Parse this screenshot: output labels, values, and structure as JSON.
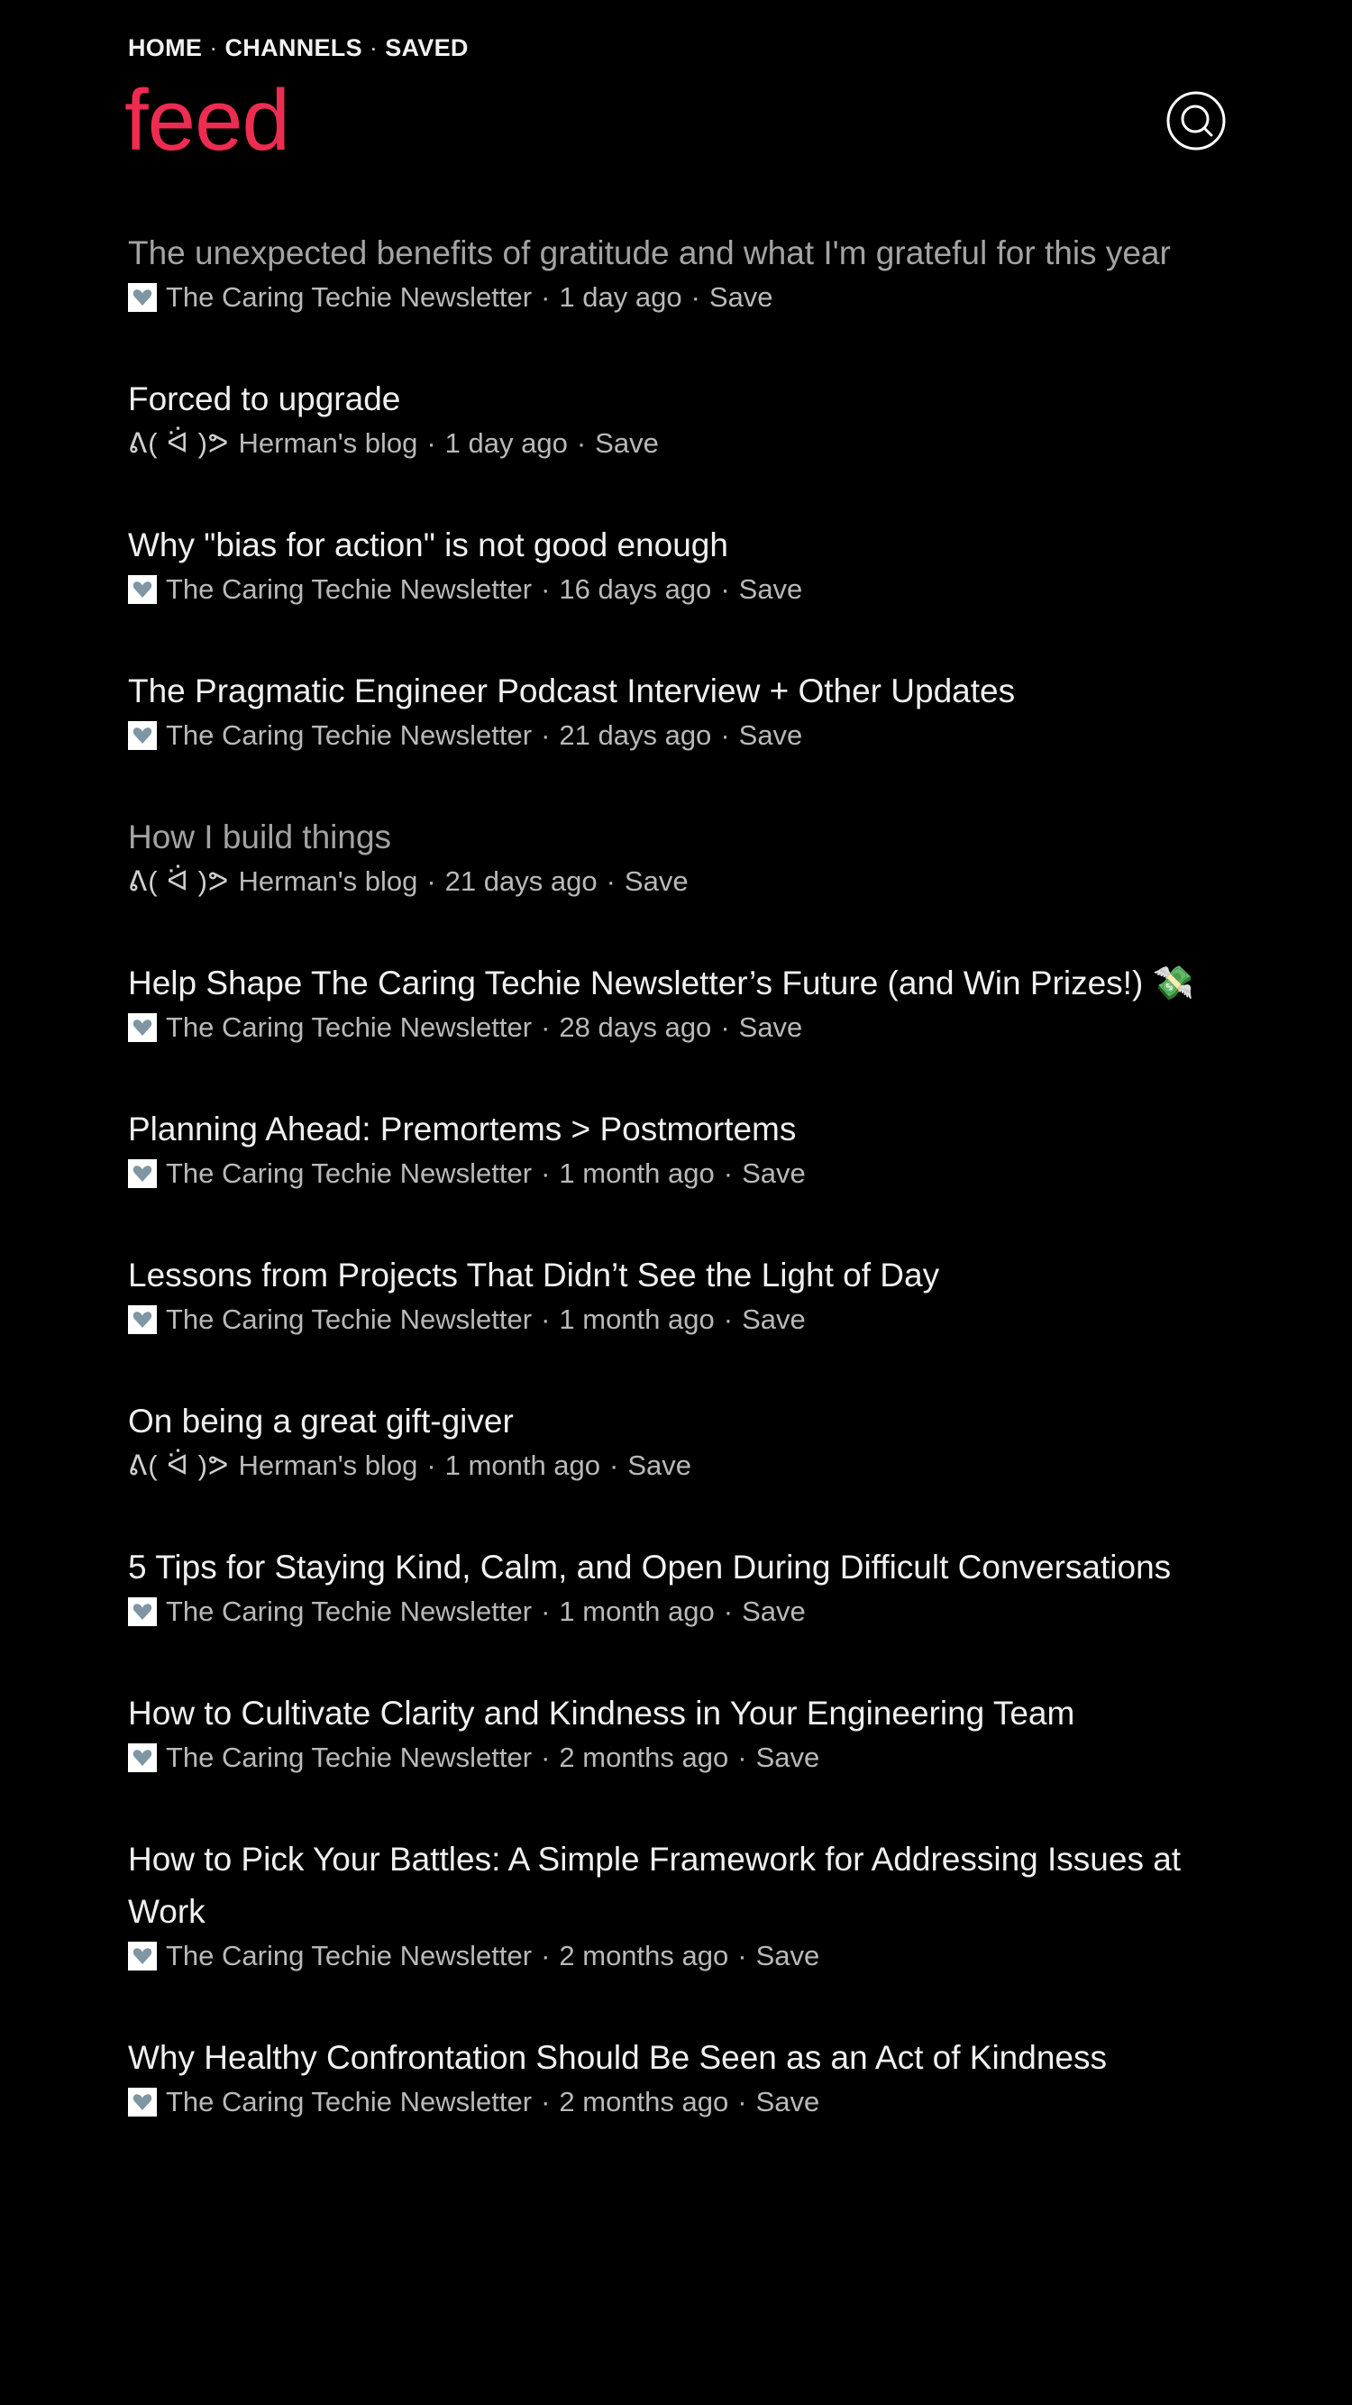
{
  "nav": {
    "home": "HOME",
    "channels": "CHANNELS",
    "saved": "SAVED",
    "separator": "·"
  },
  "header": {
    "title": "feed",
    "search_icon": "search-icon"
  },
  "colors": {
    "accent": "#ee2c52",
    "background": "#000000",
    "text": "#f0f0f0",
    "visited_text": "#a3a3a3",
    "meta_text": "#b9b9b9"
  },
  "feed": {
    "items": [
      {
        "title": "The unexpected benefits of gratitude and what I'm grateful for this year",
        "source": "The Caring Techie Newsletter",
        "favicon": "heart-badge-icon",
        "age": "1 day ago",
        "action": "Save",
        "visited": true
      },
      {
        "title": "Forced to upgrade",
        "source": "Herman's blog",
        "favicon_text": "ᕕ( ᐛ )ᕗ",
        "age": "1 day ago",
        "action": "Save",
        "visited": false
      },
      {
        "title": "Why \"bias for action\" is not good enough",
        "source": "The Caring Techie Newsletter",
        "favicon": "heart-badge-icon",
        "age": "16 days ago",
        "action": "Save",
        "visited": false
      },
      {
        "title": "The Pragmatic Engineer Podcast Interview + Other Updates",
        "source": "The Caring Techie Newsletter",
        "favicon": "heart-badge-icon",
        "age": "21 days ago",
        "action": "Save",
        "visited": false
      },
      {
        "title": "How I build things",
        "source": "Herman's blog",
        "favicon_text": "ᕕ( ᐛ )ᕗ",
        "age": "21 days ago",
        "action": "Save",
        "visited": true
      },
      {
        "title": "Help Shape The Caring Techie Newsletter’s Future (and Win Prizes!) 💸",
        "source": "The Caring Techie Newsletter",
        "favicon": "heart-badge-icon",
        "age": "28 days ago",
        "action": "Save",
        "visited": false
      },
      {
        "title": "Planning Ahead: Premortems > Postmortems",
        "source": "The Caring Techie Newsletter",
        "favicon": "heart-badge-icon",
        "age": "1 month ago",
        "action": "Save",
        "visited": false
      },
      {
        "title": "Lessons from Projects That Didn’t See the Light of Day",
        "source": "The Caring Techie Newsletter",
        "favicon": "heart-badge-icon",
        "age": "1 month ago",
        "action": "Save",
        "visited": false
      },
      {
        "title": "On being a great gift-giver",
        "source": "Herman's blog",
        "favicon_text": "ᕕ( ᐛ )ᕗ",
        "age": "1 month ago",
        "action": "Save",
        "visited": false
      },
      {
        "title": "5 Tips for Staying Kind, Calm, and Open During Difficult Conversations",
        "source": "The Caring Techie Newsletter",
        "favicon": "heart-badge-icon",
        "age": "1 month ago",
        "action": "Save",
        "visited": false
      },
      {
        "title": "How to Cultivate Clarity and Kindness in Your Engineering Team",
        "source": "The Caring Techie Newsletter",
        "favicon": "heart-badge-icon",
        "age": "2 months ago",
        "action": "Save",
        "visited": false
      },
      {
        "title": "How to Pick Your Battles: A Simple Framework for Addressing Issues at Work",
        "source": "The Caring Techie Newsletter",
        "favicon": "heart-badge-icon",
        "age": "2 months ago",
        "action": "Save",
        "visited": false
      },
      {
        "title": "Why Healthy Confrontation Should Be Seen as an Act of Kindness",
        "source": "The Caring Techie Newsletter",
        "favicon": "heart-badge-icon",
        "age": "2 months ago",
        "action": "Save",
        "visited": false
      }
    ]
  }
}
